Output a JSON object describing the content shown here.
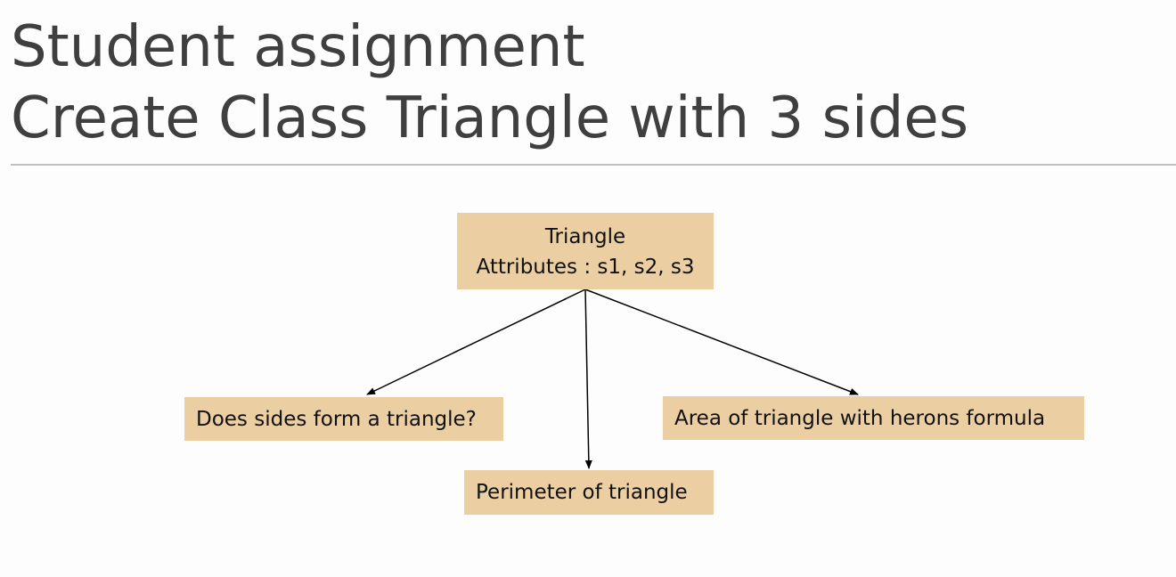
{
  "title": {
    "line1": "Student assignment",
    "line2": "Create Class Triangle with 3 sides"
  },
  "diagram": {
    "class_box": {
      "name": "Triangle",
      "attributes": "Attributes : s1, s2, s3"
    },
    "children": [
      {
        "label": "Does sides form a triangle?"
      },
      {
        "label": "Perimeter of triangle"
      },
      {
        "label": "Area of triangle with herons formula"
      }
    ],
    "colors": {
      "box_fill": "#ebcfa3",
      "arrow": "#000000",
      "title_text": "#3f3f3f",
      "divider": "#bfbfbf"
    }
  }
}
